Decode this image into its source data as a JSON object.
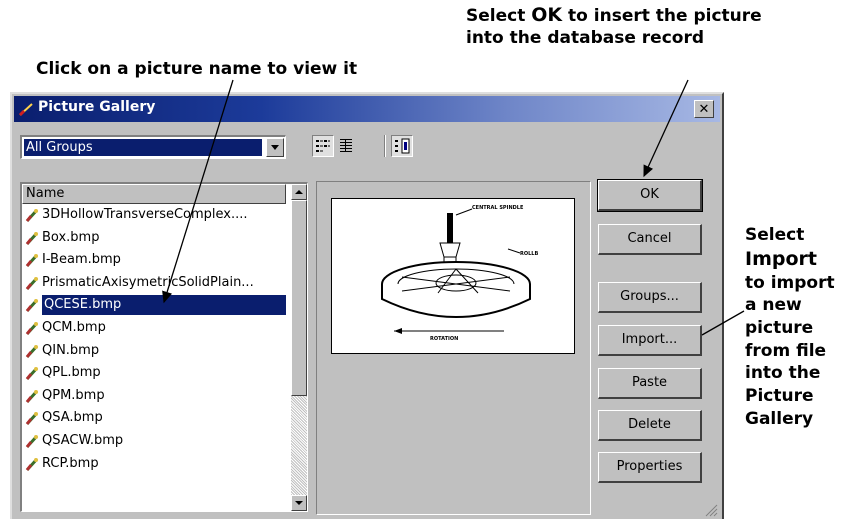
{
  "annotations": {
    "top_right": {
      "line1_prefix": "Select ",
      "line1_bold": "OK",
      "line1_suffix": " to insert the picture",
      "line2": "into the database record"
    },
    "left": "Click on a picture name to view it",
    "right": {
      "line1": "Select",
      "line2": "Import",
      "line3": "to import",
      "line4": "a new",
      "line5": "picture",
      "line6": "from file",
      "line7": "into the",
      "line8": "Picture",
      "line9": "Gallery"
    }
  },
  "dialog": {
    "title": "Picture Gallery",
    "close_label": "✕",
    "groups_select": {
      "value": "All Groups"
    },
    "list": {
      "header": "Name",
      "items": [
        {
          "label": "3DHollowTransverseComplex...."
        },
        {
          "label": "Box.bmp"
        },
        {
          "label": "I-Beam.bmp"
        },
        {
          "label": "PrismaticAxisymetricSolidPlain..."
        },
        {
          "label": "QCESE.bmp",
          "selected": true
        },
        {
          "label": "QCM.bmp"
        },
        {
          "label": "QIN.bmp"
        },
        {
          "label": "QPL.bmp"
        },
        {
          "label": "QPM.bmp"
        },
        {
          "label": "QSA.bmp"
        },
        {
          "label": "QSACW.bmp"
        },
        {
          "label": "RCP.bmp"
        }
      ]
    },
    "preview": {
      "label_central": "CENTRAL SPINDLE",
      "label_rollb": "ROLLB",
      "label_rotation": "ROTATION"
    },
    "buttons": {
      "ok": "OK",
      "cancel": "Cancel",
      "groups": "Groups...",
      "import": "Import...",
      "paste": "Paste",
      "delete": "Delete",
      "properties": "Properties"
    },
    "toolbar_icons": [
      "list-view-icon",
      "details-view-icon",
      "preview-toggle-icon"
    ]
  },
  "colors": {
    "title_bar": "#0a1e6e",
    "selection": "#0a1e6e",
    "face": "#c0c0c0"
  }
}
